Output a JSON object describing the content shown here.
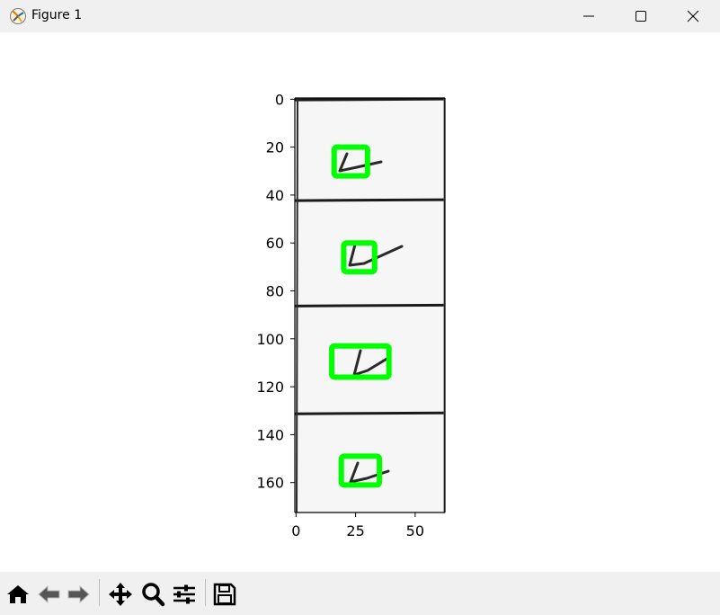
{
  "window": {
    "title": "Figure 1"
  },
  "toolbar": {
    "buttons": [
      "home-icon",
      "back-icon",
      "forward-icon",
      "pan-icon",
      "zoom-icon",
      "configure-icon",
      "save-icon"
    ]
  },
  "chart_data": {
    "type": "image",
    "image_width": 63,
    "image_height": 173,
    "xlim": [
      0,
      62
    ],
    "ylim": [
      172,
      0
    ],
    "x_ticks": [
      "0",
      "25",
      "50"
    ],
    "y_ticks": [
      "0",
      "20",
      "40",
      "60",
      "80",
      "100",
      "120",
      "140",
      "160"
    ],
    "boxes_color": "#00ff00",
    "boxes": [
      {
        "x1": 16,
        "y1": 20,
        "x2": 30,
        "y2": 32
      },
      {
        "x1": 20,
        "y1": 60,
        "x2": 33,
        "y2": 72
      },
      {
        "x1": 15,
        "y1": 103,
        "x2": 39,
        "y2": 116
      },
      {
        "x1": 19,
        "y1": 149,
        "x2": 35,
        "y2": 161
      }
    ]
  }
}
